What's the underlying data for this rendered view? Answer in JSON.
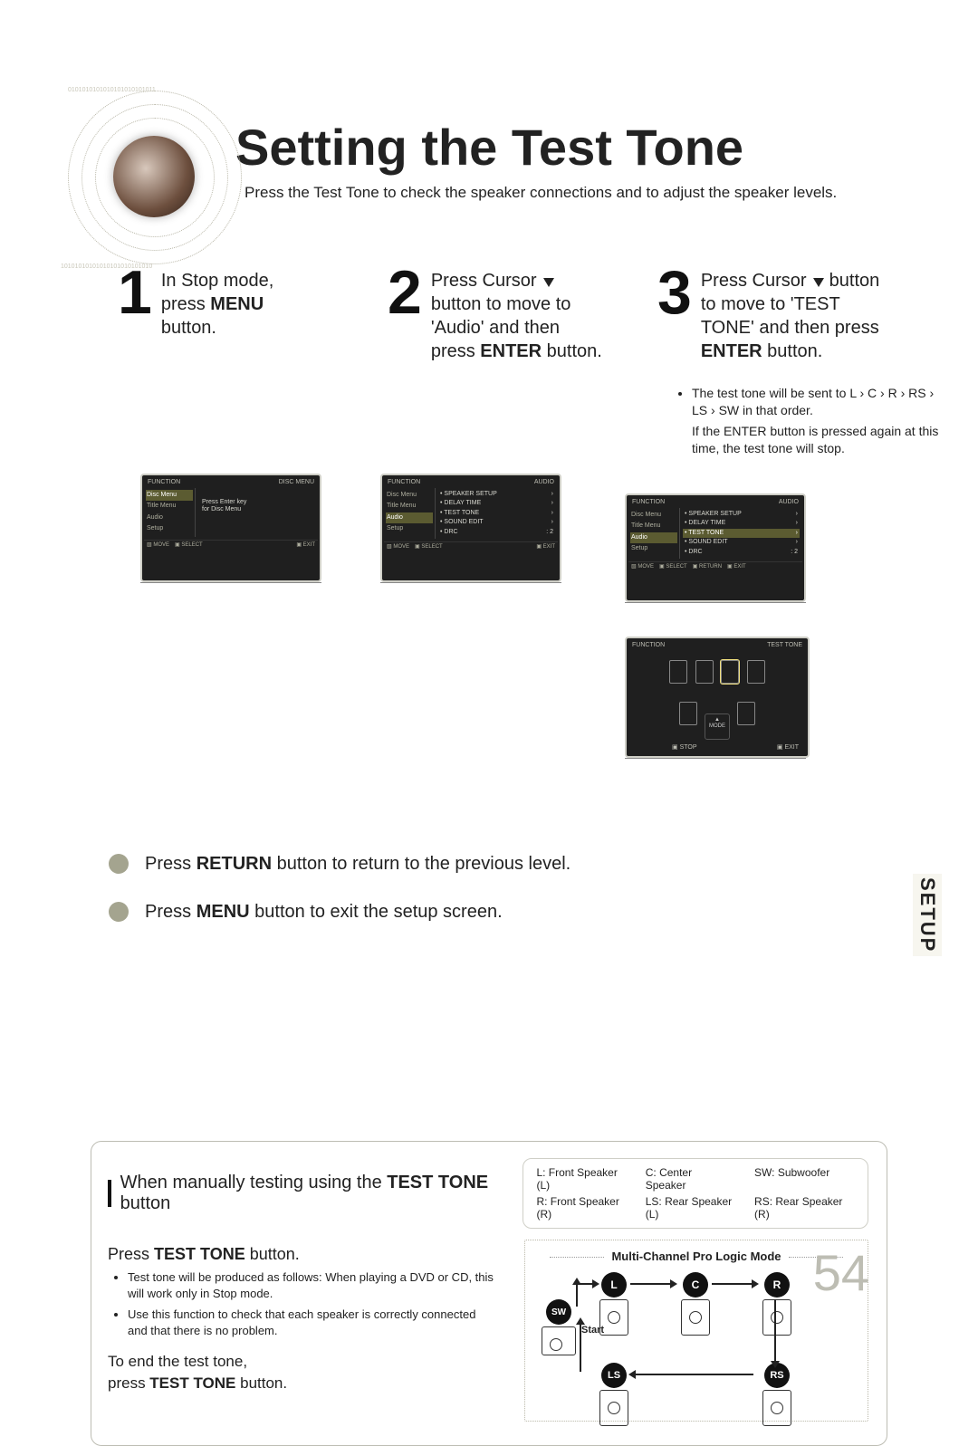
{
  "title": "Setting the Test Tone",
  "subtitle": "Press the Test Tone to check the speaker connections and to adjust the speaker levels.",
  "steps": {
    "s1": {
      "num": "1",
      "line1": "In Stop mode,",
      "line2_pre": "press ",
      "line2_b": "MENU",
      "line3": "button."
    },
    "s2": {
      "num": "2",
      "line1_pre": "Press Cursor ",
      "line2": "button to move to",
      "line3": "'Audio' and then",
      "line4_pre": "press ",
      "line4_b": "ENTER",
      "line4_post": " button."
    },
    "s3": {
      "num": "3",
      "line1_pre": "Press Cursor ",
      "line1_post": " button",
      "line2": "to move to 'TEST",
      "line3": "TONE' and then press",
      "line4_b": "ENTER",
      "line4_post": " button."
    }
  },
  "step3_notes": {
    "n1": "The test tone will be sent to L › C › R › RS › LS › SW in that order.",
    "n2": "If the ENTER button is pressed again at this time, the test tone will stop."
  },
  "osd": {
    "common": {
      "function_label": "FUNCTION",
      "move": "MOVE",
      "select": "SELECT",
      "ret": "RETURN",
      "exit": "EXIT",
      "side": {
        "disc_menu": "Disc Menu",
        "title_menu": "Title Menu",
        "audio": "Audio",
        "setup": "Setup"
      }
    },
    "osd1": {
      "disc_menu": "DISC MENU",
      "msg1": "Press Enter key",
      "msg2": "for Disc Menu"
    },
    "osd2": {
      "header": "AUDIO",
      "items": {
        "speaker_setup": "SPEAKER SETUP",
        "delay_time": "DELAY TIME",
        "test_tone": "TEST TONE",
        "sound_edit": "SOUND EDIT",
        "drc_label": "DRC",
        "drc_val": ": 2"
      }
    },
    "osd3": {
      "header": "AUDIO",
      "items": {
        "speaker_setup": "SPEAKER SETUP",
        "delay_time": "DELAY TIME",
        "test_tone": "TEST TONE",
        "sound_edit": "SOUND EDIT",
        "drc_label": "DRC",
        "drc_val": ": 2"
      }
    },
    "osd4": {
      "header": "TEST TONE",
      "stop": "STOP",
      "exit": "EXIT"
    }
  },
  "press_lines": {
    "ret_pre": "Press ",
    "ret_b": "RETURN",
    "ret_post": " button to return to the previous level.",
    "menu_pre": "Press ",
    "menu_b": "MENU",
    "menu_post": " button to exit the setup screen."
  },
  "side_tab": "SETUP",
  "manual": {
    "title_pre": "When manually testing using the ",
    "title_b": "TEST TONE",
    "title_post": " button",
    "legend": {
      "l": "L: Front Speaker (L)",
      "c": "C: Center Speaker",
      "sw": "SW: Subwoofer",
      "r": "R: Front Speaker (R)",
      "ls": "LS: Rear Speaker (L)",
      "rs": "RS: Rear Speaker (R)"
    },
    "press_line_pre": "Press ",
    "press_line_b": "TEST TONE",
    "press_line_post": " button.",
    "bullets": {
      "b1": "Test tone will be produced as follows: When playing a DVD or CD, this will work only in Stop mode.",
      "b2": "Use this function to check that each speaker is correctly connected and that there is no problem."
    },
    "end_pre": "To end the test tone,",
    "end_line_pre": "press ",
    "end_line_b": "TEST TONE",
    "end_line_post": " button.",
    "diagram_title": "Multi-Channel Pro Logic Mode",
    "start": "Start",
    "badges": {
      "l": "L",
      "c": "C",
      "r": "R",
      "sw": "SW",
      "ls": "LS",
      "rs": "RS"
    }
  },
  "page_number": "54"
}
